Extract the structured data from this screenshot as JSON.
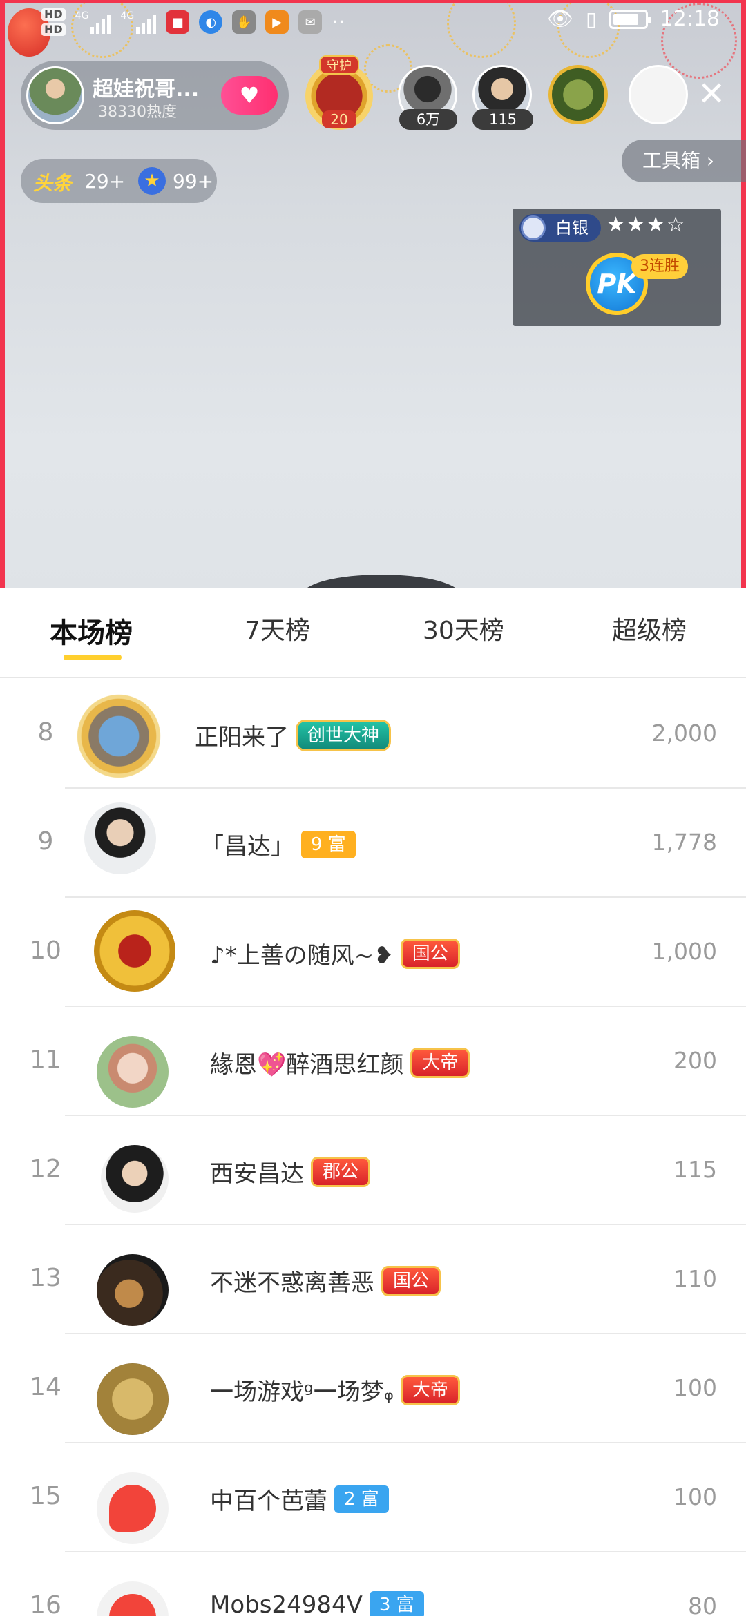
{
  "status_bar": {
    "network": "4G",
    "time": "12:18"
  },
  "anchor": {
    "name": "超娃祝哥...",
    "heat": "38330热度"
  },
  "guard": {
    "label": "守护",
    "count": "20"
  },
  "viewers": [
    {
      "badge": "6万"
    },
    {
      "badge": "115"
    }
  ],
  "hotbar": {
    "toutiao_label": "头条",
    "toutiao_count": "29+",
    "star_count": "99+"
  },
  "toolbox": {
    "label": "工具箱 ›"
  },
  "pk": {
    "tier": "白银",
    "stars": "★★★☆",
    "ball": "PK",
    "streak": "3连胜"
  },
  "tabs": [
    {
      "label": "本场榜"
    },
    {
      "label": "7天榜"
    },
    {
      "label": "30天榜"
    },
    {
      "label": "超级榜"
    }
  ],
  "ranking": [
    {
      "rank": "8",
      "name": "正阳来了",
      "badge": "创世大神",
      "score": "2,000"
    },
    {
      "rank": "9",
      "name": "「昌达」",
      "badge": "9 富",
      "score": "1,778"
    },
    {
      "rank": "10",
      "name": "♪*上善の随风~❥",
      "badge": "国公",
      "score": "1,000"
    },
    {
      "rank": "11",
      "name": "緣恩💖醉酒思红颜",
      "badge": "大帝",
      "score": "200"
    },
    {
      "rank": "12",
      "name": "西安昌达",
      "badge": "郡公",
      "score": "115"
    },
    {
      "rank": "13",
      "name": "不迷不惑离善恶",
      "badge": "国公",
      "score": "110"
    },
    {
      "rank": "14",
      "name": "一场游戏ᵍ一场梦ᵩ",
      "badge": "大帝",
      "score": "100"
    },
    {
      "rank": "15",
      "name": "中百个芭蕾",
      "badge": "2 富",
      "score": "100"
    },
    {
      "rank": "16",
      "name": "Mobs24984V",
      "badge": "3 富",
      "score": "80"
    }
  ]
}
